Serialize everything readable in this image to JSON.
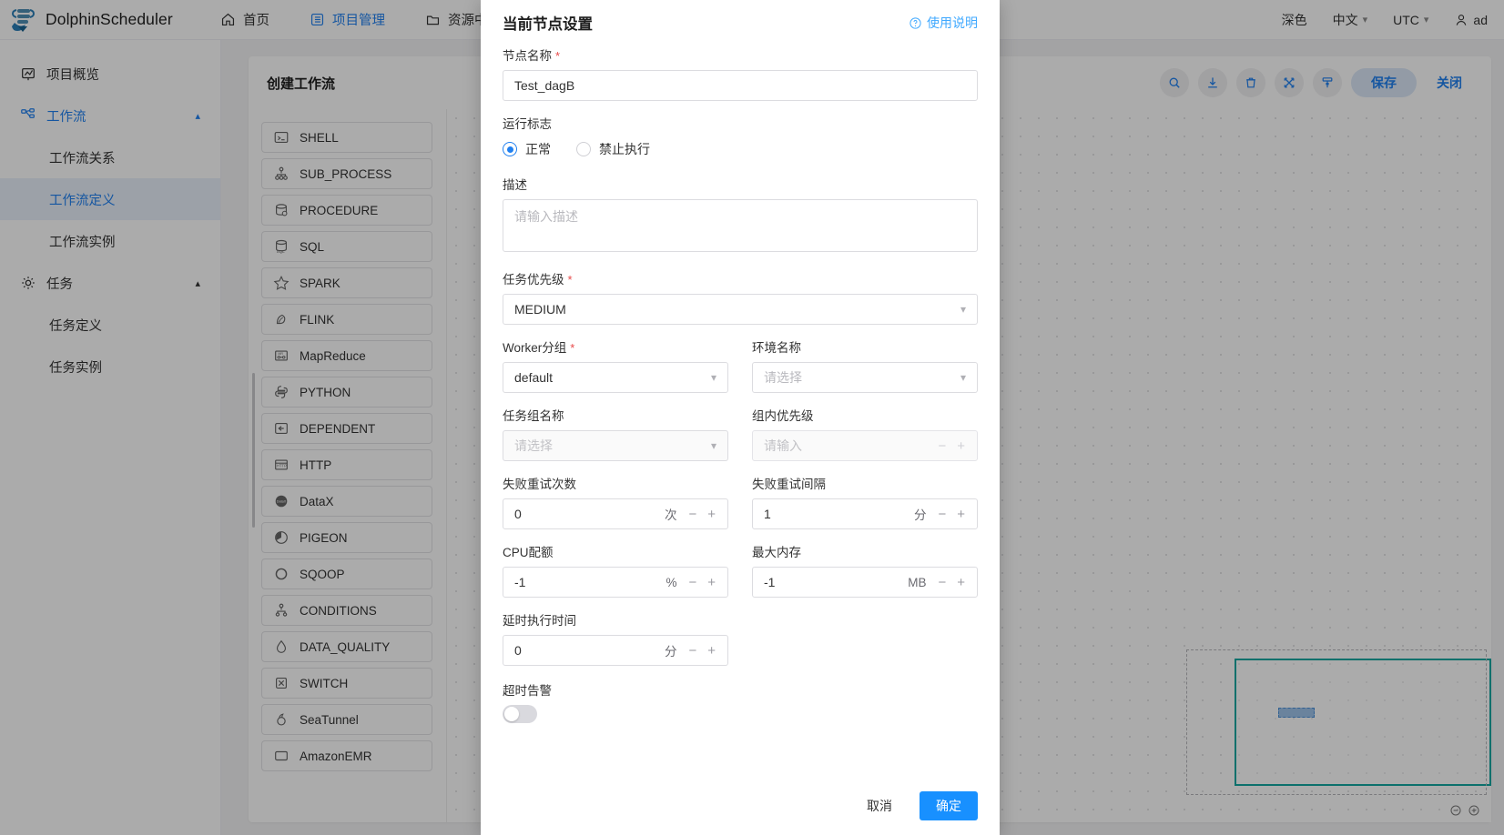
{
  "app": {
    "brand": "DolphinScheduler",
    "nav": [
      {
        "label": "首页",
        "icon": "home-icon",
        "active": false
      },
      {
        "label": "项目管理",
        "icon": "project-icon",
        "active": true
      },
      {
        "label": "资源中心",
        "icon": "folder-icon",
        "active": false
      }
    ],
    "nav_right": {
      "theme": "深色",
      "language": "中文",
      "timezone": "UTC",
      "user": "ad"
    }
  },
  "sidebar": {
    "items": [
      {
        "label": "项目概览",
        "type": "row",
        "icon": "overview-icon"
      },
      {
        "label": "工作流",
        "type": "group",
        "icon": "workflow-icon",
        "expanded": true
      },
      {
        "label": "工作流关系",
        "type": "sub"
      },
      {
        "label": "工作流定义",
        "type": "sub",
        "selected": true
      },
      {
        "label": "工作流实例",
        "type": "sub"
      },
      {
        "label": "任务",
        "type": "group",
        "icon": "gear-icon",
        "expanded": true
      },
      {
        "label": "任务定义",
        "type": "sub"
      },
      {
        "label": "任务实例",
        "type": "sub"
      }
    ]
  },
  "page": {
    "title": "创建工作流",
    "toolbar": {
      "icons": [
        "search-icon",
        "download-icon",
        "delete-icon",
        "fullscreen-icon",
        "format-icon"
      ],
      "save_label": "保存",
      "close_label": "关闭"
    },
    "zoom_label": "",
    "task_types": [
      {
        "label": "SHELL",
        "icon": "shell-icon"
      },
      {
        "label": "SUB_PROCESS",
        "icon": "subprocess-icon"
      },
      {
        "label": "PROCEDURE",
        "icon": "procedure-icon"
      },
      {
        "label": "SQL",
        "icon": "sql-icon"
      },
      {
        "label": "SPARK",
        "icon": "spark-icon"
      },
      {
        "label": "FLINK",
        "icon": "flink-icon"
      },
      {
        "label": "MapReduce",
        "icon": "mapreduce-icon"
      },
      {
        "label": "PYTHON",
        "icon": "python-icon"
      },
      {
        "label": "DEPENDENT",
        "icon": "dependent-icon"
      },
      {
        "label": "HTTP",
        "icon": "http-icon"
      },
      {
        "label": "DataX",
        "icon": "datax-icon"
      },
      {
        "label": "PIGEON",
        "icon": "pigeon-icon"
      },
      {
        "label": "SQOOP",
        "icon": "sqoop-icon"
      },
      {
        "label": "CONDITIONS",
        "icon": "conditions-icon"
      },
      {
        "label": "DATA_QUALITY",
        "icon": "dataquality-icon"
      },
      {
        "label": "SWITCH",
        "icon": "switch-icon"
      },
      {
        "label": "SeaTunnel",
        "icon": "seatunnel-icon"
      },
      {
        "label": "AmazonEMR",
        "icon": "emr-icon"
      }
    ]
  },
  "modal": {
    "title": "当前节点设置",
    "help_label": "使用说明",
    "fields": {
      "node_name": {
        "label": "节点名称",
        "required": true,
        "value": "Test_dagB"
      },
      "run_flag": {
        "label": "运行标志",
        "options": [
          {
            "label": "正常",
            "checked": true
          },
          {
            "label": "禁止执行",
            "checked": false
          }
        ]
      },
      "description": {
        "label": "描述",
        "value": "",
        "placeholder": "请输入描述"
      },
      "task_priority": {
        "label": "任务优先级",
        "required": true,
        "value": "MEDIUM"
      },
      "worker_group": {
        "label": "Worker分组",
        "required": true,
        "value": "default"
      },
      "environment_name": {
        "label": "环境名称",
        "value": "",
        "placeholder": "请选择"
      },
      "task_group_name": {
        "label": "任务组名称",
        "value": "",
        "placeholder": "请选择",
        "disabled": true
      },
      "task_group_priority": {
        "label": "组内优先级",
        "value": "",
        "placeholder": "请输入",
        "disabled": true
      },
      "failure_retry_times": {
        "label": "失败重试次数",
        "value": "0",
        "unit": "次"
      },
      "failure_retry_interval": {
        "label": "失败重试间隔",
        "value": "1",
        "unit": "分"
      },
      "cpu_quota": {
        "label": "CPU配额",
        "value": "-1",
        "unit": "%"
      },
      "max_memory": {
        "label": "最大内存",
        "value": "-1",
        "unit": "MB"
      },
      "delay_execution_time": {
        "label": "延时执行时间",
        "value": "0",
        "unit": "分"
      },
      "timeout_alarm": {
        "label": "超时告警",
        "enabled": false
      }
    },
    "footer": {
      "cancel": "取消",
      "confirm": "确定"
    }
  }
}
